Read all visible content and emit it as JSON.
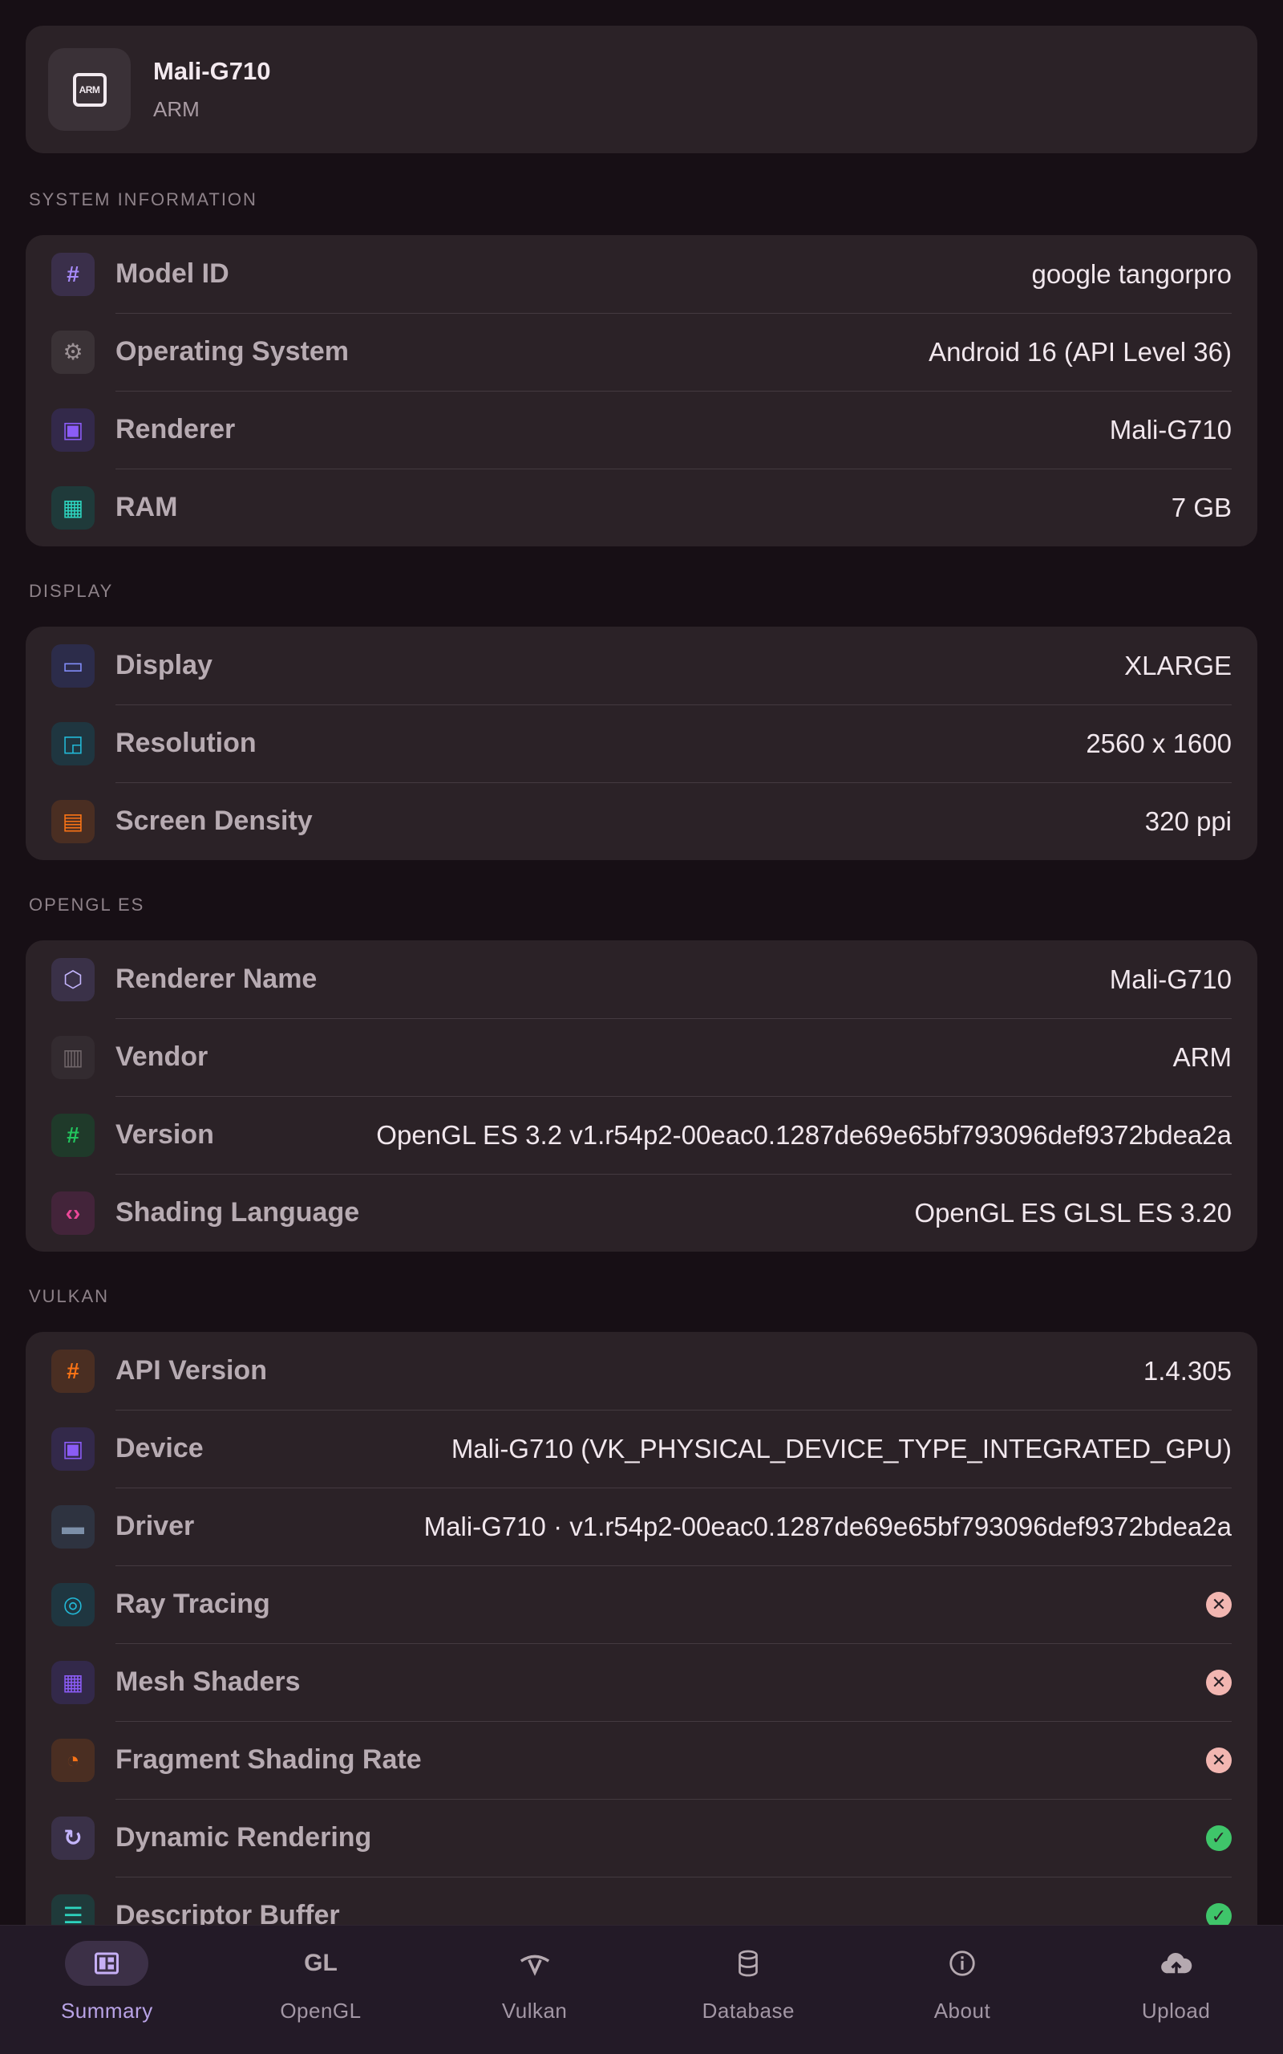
{
  "device": {
    "name": "Mali-G710",
    "vendor": "ARM",
    "logo_text": "ARM"
  },
  "sections": {
    "system": {
      "title": "SYSTEM INFORMATION",
      "rows": [
        {
          "label": "Model ID",
          "value": "google  tangorpro",
          "icon": "hash-icon",
          "icon_glyph": "#",
          "fg": "#a78bfa",
          "bg": "#3a2f4a"
        },
        {
          "label": "Operating System",
          "value": "Android 16 (API Level 36)",
          "icon": "gear-icon",
          "icon_glyph": "⚙",
          "fg": "#9c9296",
          "bg": "#3a3236"
        },
        {
          "label": "Renderer",
          "value": "Mali-G710",
          "icon": "chip-icon",
          "icon_glyph": "▣",
          "fg": "#8b5cf6",
          "bg": "#33294a"
        },
        {
          "label": "RAM",
          "value": "7 GB",
          "icon": "memory-icon",
          "icon_glyph": "▦",
          "fg": "#2dd4bf",
          "bg": "#1f3a3a"
        }
      ]
    },
    "display": {
      "title": "DISPLAY",
      "rows": [
        {
          "label": "Display",
          "value": "XLARGE",
          "icon": "monitor-icon",
          "icon_glyph": "▭",
          "fg": "#818cf8",
          "bg": "#2c2c4a"
        },
        {
          "label": "Resolution",
          "value": "2560 x 1600",
          "icon": "aspect-ratio-icon",
          "icon_glyph": "◲",
          "fg": "#22b8d6",
          "bg": "#1f3640"
        },
        {
          "label": "Screen Density",
          "value": "320 ppi",
          "icon": "density-icon",
          "icon_glyph": "▤",
          "fg": "#f97316",
          "bg": "#4a2e22"
        }
      ]
    },
    "opengl": {
      "title": "OPENGL ES",
      "rows": [
        {
          "label": "Renderer Name",
          "value": "Mali-G710",
          "icon": "cube-icon",
          "icon_glyph": "⬡",
          "fg": "#c4b5fd",
          "bg": "#3a3148"
        },
        {
          "label": "Vendor",
          "value": "ARM",
          "icon": "building-icon",
          "icon_glyph": "▥",
          "fg": "#6f6569",
          "bg": "#332b30"
        },
        {
          "label": "Version",
          "value": "OpenGL ES 3.2 v1.r54p2-00eac0.1287de69e65bf793096def9372bdea2a",
          "icon": "hash-icon",
          "icon_glyph": "#",
          "fg": "#22c55e",
          "bg": "#1f3a2a"
        },
        {
          "label": "Shading Language",
          "value": "OpenGL ES GLSL ES 3.20",
          "icon": "code-icon",
          "icon_glyph": "‹›",
          "fg": "#ec4899",
          "bg": "#43243a"
        }
      ]
    },
    "vulkan": {
      "title": "VULKAN",
      "rows": [
        {
          "label": "API Version",
          "value": "1.4.305",
          "icon": "hash-icon",
          "icon_glyph": "#",
          "fg": "#f97316",
          "bg": "#4a2e22"
        },
        {
          "label": "Device",
          "value": "Mali-G710 (VK_PHYSICAL_DEVICE_TYPE_INTEGRATED_GPU)",
          "icon": "chip-icon",
          "icon_glyph": "▣",
          "fg": "#8b5cf6",
          "bg": "#33294a"
        },
        {
          "label": "Driver",
          "value": "Mali-G710 · v1.r54p2-00eac0.1287de69e65bf793096def9372bdea2a",
          "icon": "car-icon",
          "icon_glyph": "▬",
          "fg": "#7c8fa8",
          "bg": "#2e3340"
        },
        {
          "label": "Ray Tracing",
          "status": "no",
          "icon": "target-icon",
          "icon_glyph": "◎",
          "fg": "#22b8d6",
          "bg": "#1f3640"
        },
        {
          "label": "Mesh Shaders",
          "status": "no",
          "icon": "grid-icon",
          "icon_glyph": "▦",
          "fg": "#8b5cf6",
          "bg": "#33294a"
        },
        {
          "label": "Fragment Shading Rate",
          "status": "no",
          "icon": "speedometer-icon",
          "icon_glyph": "◔",
          "fg": "#f97316",
          "bg": "#4a2e22"
        },
        {
          "label": "Dynamic Rendering",
          "status": "yes",
          "icon": "refresh-icon",
          "icon_glyph": "↻",
          "fg": "#c4b5fd",
          "bg": "#3a3148"
        },
        {
          "label": "Descriptor Buffer",
          "status": "yes",
          "icon": "list-icon",
          "icon_glyph": "☰",
          "fg": "#2dd4bf",
          "bg": "#1f3a3a"
        }
      ]
    }
  },
  "nav": [
    {
      "label": "Summary",
      "icon": "dashboard-icon",
      "active": true
    },
    {
      "label": "OpenGL",
      "icon": "gl-icon",
      "active": false
    },
    {
      "label": "Vulkan",
      "icon": "vulkan-icon",
      "active": false
    },
    {
      "label": "Database",
      "icon": "database-icon",
      "active": false
    },
    {
      "label": "About",
      "icon": "info-icon",
      "active": false
    },
    {
      "label": "Upload",
      "icon": "cloud-upload-icon",
      "active": false
    }
  ],
  "nav_gl_text": "GL",
  "status_glyphs": {
    "no": "✕",
    "yes": "✓"
  }
}
